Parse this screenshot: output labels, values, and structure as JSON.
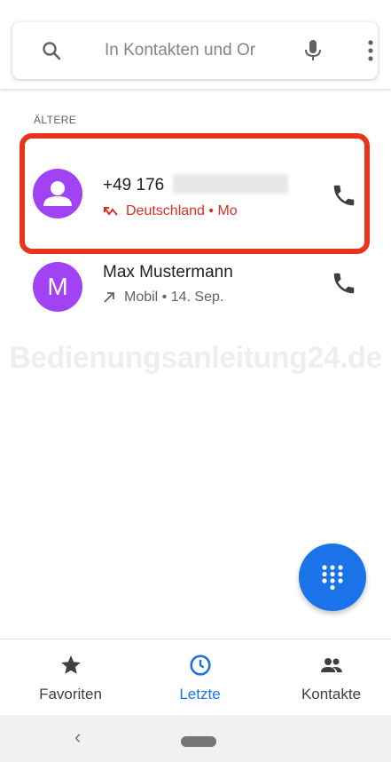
{
  "search": {
    "placeholder": "In Kontakten und Or"
  },
  "section": {
    "header": "ÄLTERE"
  },
  "calls": [
    {
      "number": "+49 176",
      "detail": "Deutschland • Mo",
      "type": "missed",
      "avatar_icon": "person-icon",
      "avatar_color": "#a142f4"
    },
    {
      "name": "Max Mustermann",
      "avatar_letter": "M",
      "detail": "Mobil • 14. Sep.",
      "type": "outgoing",
      "avatar_color": "#a142f4"
    }
  ],
  "watermark": "Bedienungsanleitung24.de",
  "nav": {
    "favorites": "Favoriten",
    "recent": "Letzte",
    "contacts": "Kontakte"
  },
  "system_nav": {
    "back": "‹"
  },
  "colors": {
    "accent": "#1a73e8",
    "missed": "#d93025",
    "highlight": "#e8341c"
  }
}
